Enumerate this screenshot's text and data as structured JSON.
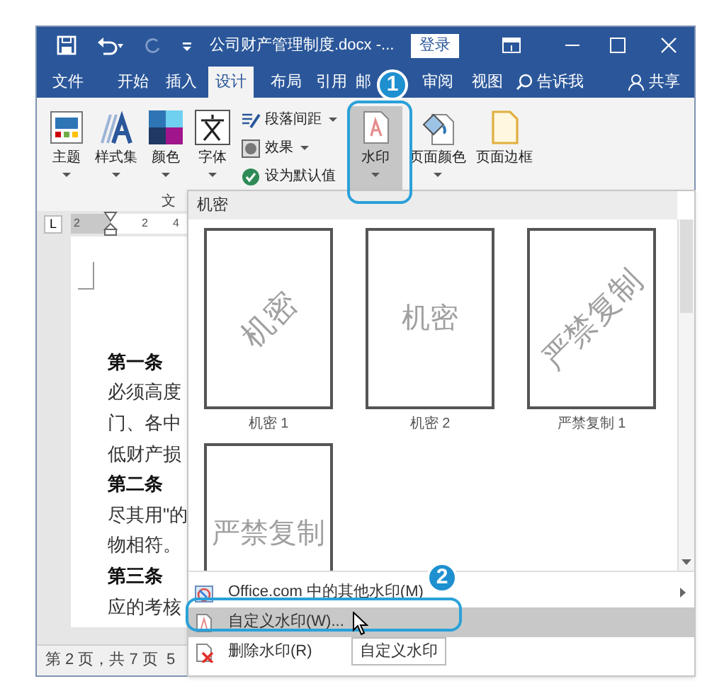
{
  "title_bar": {
    "title": "公司财产管理制度.docx -...",
    "login_button": "登录"
  },
  "tabs": [
    {
      "label": "文件",
      "selected": false
    },
    {
      "label": "开始",
      "selected": false
    },
    {
      "label": "插入",
      "selected": false
    },
    {
      "label": "设计",
      "selected": true
    },
    {
      "label": "布局",
      "selected": false
    },
    {
      "label": "引用",
      "selected": false
    },
    {
      "label": "邮",
      "selected": false
    },
    {
      "label": "审阅",
      "selected": false
    },
    {
      "label": "视图",
      "selected": false
    }
  ],
  "search": {
    "placeholder": "告诉我"
  },
  "share_button": "共享",
  "ribbon": {
    "large_buttons": [
      {
        "label": "主题",
        "kind": "theme",
        "dropdown": true,
        "pressed": false
      },
      {
        "label": "样式集",
        "kind": "styles",
        "dropdown": true,
        "pressed": false
      },
      {
        "label": "颜色",
        "kind": "colors",
        "dropdown": true,
        "pressed": false
      },
      {
        "label": "字体",
        "kind": "fonts",
        "dropdown": true,
        "pressed": false
      }
    ],
    "small_buttons": [
      {
        "label": "段落间距",
        "kind": "spacing",
        "dropdown": true
      },
      {
        "label": "效果",
        "kind": "effects",
        "dropdown": true
      },
      {
        "label": "设为默认值",
        "kind": "default",
        "dropdown": false
      }
    ],
    "page_buttons": [
      {
        "label": "水印",
        "kind": "watermark",
        "dropdown": true,
        "pressed": true
      },
      {
        "label": "页面颜色",
        "kind": "page_color",
        "dropdown": true,
        "pressed": false
      },
      {
        "label": "页面边框",
        "kind": "page_border",
        "dropdown": false,
        "pressed": false
      }
    ],
    "group_label": "文"
  },
  "ruler": {
    "tab_selector": "L",
    "numbers": [
      "2",
      "2",
      "4"
    ]
  },
  "document_lines": [
    {
      "text": "第一条",
      "bold": true
    },
    {
      "text": "必须高度",
      "bold": false
    },
    {
      "text": "门、各中",
      "bold": false
    },
    {
      "text": "低财产损",
      "bold": false
    },
    {
      "text": "第二条",
      "bold": true
    },
    {
      "text": "尽其用\"的",
      "bold": false
    },
    {
      "text": "物相符。",
      "bold": false
    },
    {
      "text": "第三条",
      "bold": true
    },
    {
      "text": "应的考核",
      "bold": false
    }
  ],
  "status_bar": [
    "第 2 页，共 7 页",
    "5"
  ],
  "watermark_menu": {
    "section": "机密",
    "gallery": [
      {
        "label": "机密 1",
        "watermark": "机密",
        "kind": "diagonal"
      },
      {
        "label": "机密 2",
        "watermark": "机密",
        "kind": "horizontal"
      },
      {
        "label": "严禁复制 1",
        "watermark": "严禁复制",
        "kind": "diagonal"
      },
      {
        "watermark": "严禁复制",
        "kind": "horizontal"
      }
    ],
    "items": [
      {
        "label": "Office.com 中的其他水印(M)",
        "kind": "office",
        "submenu": true,
        "highlighted": false
      },
      {
        "label": "自定义水印(W)...",
        "kind": "custom",
        "submenu": false,
        "highlighted": true
      },
      {
        "label": "删除水印(R)",
        "kind": "delete",
        "submenu": false,
        "highlighted": false
      }
    ]
  },
  "tooltip": "自定义水印",
  "step_badges": [
    "1",
    "2"
  ]
}
